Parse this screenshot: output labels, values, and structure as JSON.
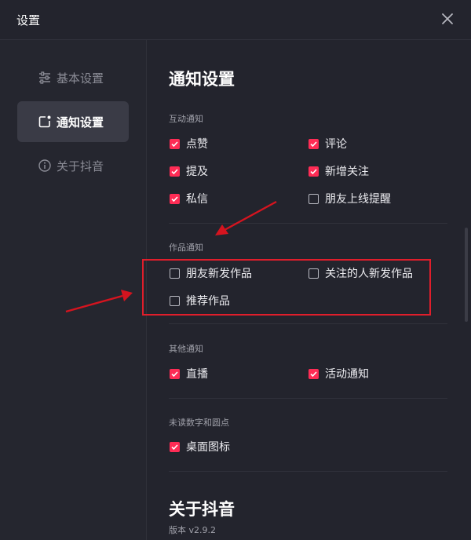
{
  "window": {
    "title": "设置"
  },
  "sidebar": {
    "items": [
      {
        "label": "基本设置",
        "icon": "sliders-icon",
        "active": false
      },
      {
        "label": "通知设置",
        "icon": "notification-icon",
        "active": true
      },
      {
        "label": "关于抖音",
        "icon": "info-icon",
        "active": false
      }
    ]
  },
  "content": {
    "title": "通知设置",
    "sections": [
      {
        "label": "互动通知"
      },
      {
        "label": "作品通知"
      },
      {
        "label": "其他通知"
      },
      {
        "label": "未读数字和圆点"
      }
    ],
    "options": {
      "like": {
        "label": "点赞",
        "checked": true
      },
      "comment": {
        "label": "评论",
        "checked": true
      },
      "mention": {
        "label": "提及",
        "checked": true
      },
      "new_follower": {
        "label": "新增关注",
        "checked": true
      },
      "message": {
        "label": "私信",
        "checked": true
      },
      "friend_online": {
        "label": "朋友上线提醒",
        "checked": false
      },
      "friend_new_work": {
        "label": "朋友新发作品",
        "checked": false
      },
      "following_new_work": {
        "label": "关注的人新发作品",
        "checked": false
      },
      "recommended_work": {
        "label": "推荐作品",
        "checked": false
      },
      "live": {
        "label": "直播",
        "checked": true
      },
      "activity": {
        "label": "活动通知",
        "checked": true
      },
      "desktop_icon": {
        "label": "桌面图标",
        "checked": true
      }
    },
    "about": {
      "title": "关于抖音",
      "version": "版本 v2.9.2"
    }
  },
  "colors": {
    "accent": "#fe2c55",
    "annotation": "#e01e2b"
  }
}
